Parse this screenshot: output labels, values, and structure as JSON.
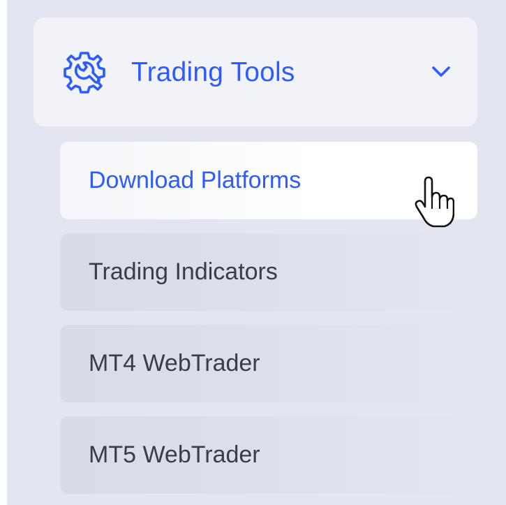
{
  "menu": {
    "title": "Trading Tools",
    "title_icon": "wrench-gear-icon",
    "expand_icon": "chevron-down-icon",
    "accent_color": "#2c5cff",
    "items": [
      {
        "label": "Download Platforms",
        "active": true
      },
      {
        "label": "Trading Indicators",
        "active": false
      },
      {
        "label": "MT4 WebTrader",
        "active": false
      },
      {
        "label": "MT5 WebTrader",
        "active": false
      }
    ]
  },
  "cursor": {
    "type": "hand-pointer-icon"
  }
}
